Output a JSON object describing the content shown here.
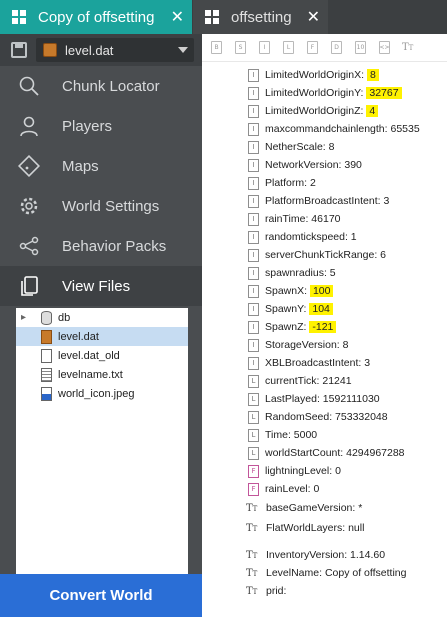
{
  "tabs": [
    {
      "label": "Copy of offsetting",
      "active": true
    },
    {
      "label": "offsetting",
      "active": false
    }
  ],
  "file_select": {
    "value": "level.dat"
  },
  "nav": [
    {
      "label": "Chunk Locator",
      "icon": "search-icon"
    },
    {
      "label": "Players",
      "icon": "user-icon"
    },
    {
      "label": "Maps",
      "icon": "map-icon"
    },
    {
      "label": "World Settings",
      "icon": "gear-icon"
    },
    {
      "label": "Behavior Packs",
      "icon": "share-icon"
    },
    {
      "label": "View Files",
      "icon": "files-icon",
      "active": true
    }
  ],
  "tree": [
    {
      "label": "db",
      "icon": "database-icon",
      "expandable": true
    },
    {
      "label": "level.dat",
      "icon": "dat-file-icon",
      "selected": true
    },
    {
      "label": "level.dat_old",
      "icon": "file-icon"
    },
    {
      "label": "levelname.txt",
      "icon": "text-file-icon"
    },
    {
      "label": "world_icon.jpeg",
      "icon": "image-file-icon"
    }
  ],
  "convert_button": "Convert World",
  "toolbar_tags": [
    "B",
    "S",
    "I",
    "L",
    "F",
    "D",
    "10",
    "<>",
    "TT"
  ],
  "properties": [
    {
      "tag": "I",
      "key": "LimitedWorldOriginX: ",
      "value": "8",
      "highlight": true
    },
    {
      "tag": "I",
      "key": "LimitedWorldOriginY: ",
      "value": "32767",
      "highlight": true
    },
    {
      "tag": "I",
      "key": "LimitedWorldOriginZ: ",
      "value": "4",
      "highlight": true
    },
    {
      "tag": "I",
      "key": "maxcommandchainlength: ",
      "value": "65535"
    },
    {
      "tag": "I",
      "key": "NetherScale: ",
      "value": "8"
    },
    {
      "tag": "I",
      "key": "NetworkVersion: ",
      "value": "390"
    },
    {
      "tag": "I",
      "key": "Platform: ",
      "value": "2"
    },
    {
      "tag": "I",
      "key": "PlatformBroadcastIntent: ",
      "value": "3"
    },
    {
      "tag": "I",
      "key": "rainTime: ",
      "value": "46170"
    },
    {
      "tag": "I",
      "key": "randomtickspeed: ",
      "value": "1"
    },
    {
      "tag": "I",
      "key": "serverChunkTickRange: ",
      "value": "6"
    },
    {
      "tag": "I",
      "key": "spawnradius: ",
      "value": "5"
    },
    {
      "tag": "I",
      "key": "SpawnX: ",
      "value": "100",
      "highlight": true
    },
    {
      "tag": "I",
      "key": "SpawnY: ",
      "value": "104",
      "highlight": true
    },
    {
      "tag": "I",
      "key": "SpawnZ: ",
      "value": "-121",
      "highlight": true
    },
    {
      "tag": "I",
      "key": "StorageVersion: ",
      "value": "8"
    },
    {
      "tag": "I",
      "key": "XBLBroadcastIntent: ",
      "value": "3"
    },
    {
      "tag": "L",
      "key": "currentTick: ",
      "value": "21241"
    },
    {
      "tag": "L",
      "key": "LastPlayed: ",
      "value": "1592111030"
    },
    {
      "tag": "L",
      "key": "RandomSeed: ",
      "value": "753332048"
    },
    {
      "tag": "L",
      "key": "Time: ",
      "value": "5000"
    },
    {
      "tag": "L",
      "key": "worldStartCount: ",
      "value": "4294967288"
    },
    {
      "tag": "F",
      "key": "lightningLevel: ",
      "value": "0"
    },
    {
      "tag": "F",
      "key": "rainLevel: ",
      "value": "0"
    },
    {
      "tag": "TT",
      "key": "baseGameVersion: ",
      "value": "*"
    },
    {
      "tag": "TT",
      "key": "FlatWorldLayers: ",
      "value": "null"
    },
    {
      "tag": "TT",
      "key": "InventoryVersion: ",
      "value": "1.14.60"
    },
    {
      "tag": "TT",
      "key": "LevelName: ",
      "value": "Copy of offsetting"
    },
    {
      "tag": "TT",
      "key": "prid: ",
      "value": ""
    }
  ],
  "colors": {
    "accent": "#1ba39c",
    "button": "#2a6ed6",
    "highlight": "#fff200"
  }
}
